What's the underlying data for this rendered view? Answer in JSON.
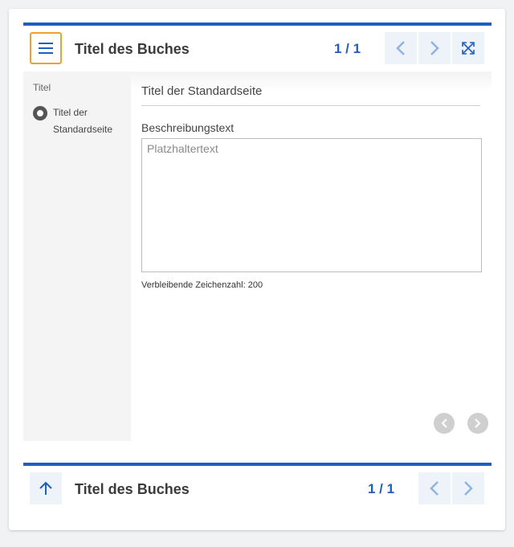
{
  "header": {
    "book_title": "Titel des Buches",
    "page_counter": "1 / 1",
    "icons": {
      "menu": "menu-icon",
      "prev": "chevron-left-icon",
      "next": "chevron-right-icon",
      "fullscreen": "expand-icon"
    }
  },
  "sidebar": {
    "heading": "Titel",
    "items": [
      {
        "label": "Titel der Standardseite",
        "selected": true
      }
    ]
  },
  "content": {
    "page_title": "Titel der Standardseite",
    "description_label": "Beschreibungstext",
    "description_value": "",
    "description_placeholder": "Platzhaltertext",
    "remaining_chars": "Verbleibende Zeichenzahl: 200"
  },
  "footer": {
    "book_title": "Titel des Buches",
    "page_counter": "1 / 1",
    "icons": {
      "up": "arrow-up-icon",
      "prev": "chevron-left-icon",
      "next": "chevron-right-icon"
    }
  },
  "colors": {
    "accent": "#1f5fbf",
    "focus": "#f0a12b",
    "button_bg": "#eef3fa",
    "sidebar_bg": "#f4f4f4"
  }
}
